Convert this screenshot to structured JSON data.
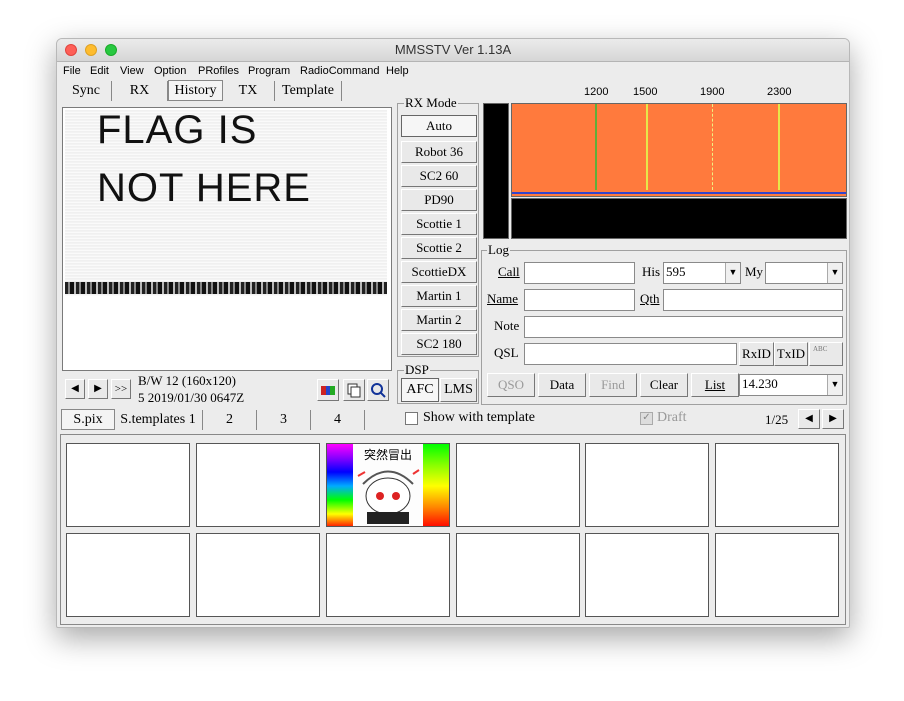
{
  "window": {
    "title": "MMSSTV Ver 1.13A"
  },
  "menu": [
    "File",
    "Edit",
    "View",
    "Option",
    "PRofiles",
    "Program",
    "RadioCommand",
    "Help"
  ],
  "tabs": [
    "Sync",
    "RX",
    "History",
    "TX",
    "Template"
  ],
  "image": {
    "line1": "FLAG IS",
    "line2": "NOT HERE"
  },
  "history_info": {
    "mode": "B/W 12 (160x120)",
    "entry": "5 2019/01/30 0647Z"
  },
  "nav": {
    "prev": "◀",
    "next": "▶",
    "skip": ">>"
  },
  "rx_mode": {
    "title": "RX Mode",
    "modes": [
      "Auto",
      "Robot 36",
      "SC2 60",
      "PD90",
      "Scottie 1",
      "Scottie 2",
      "ScottieDX",
      "Martin 1",
      "Martin 2",
      "SC2 180"
    ]
  },
  "dsp": {
    "title": "DSP",
    "afc": "AFC",
    "lms": "LMS"
  },
  "spectrum": {
    "labels": [
      "1200",
      "1500",
      "1900",
      "2300"
    ],
    "bg_color": "#ff7a3d"
  },
  "log": {
    "title": "Log",
    "call_label": "Call",
    "his_label": "His",
    "his_value": "595",
    "my_label": "My",
    "my_value": "",
    "name_label": "Name",
    "qth_label": "Qth",
    "note_label": "Note",
    "qsl_label": "QSL",
    "rxid": "RxID",
    "txid": "TxID",
    "abc": "ABC"
  },
  "log_buttons": {
    "qso": "QSO",
    "data": "Data",
    "find": "Find",
    "clear": "Clear",
    "list": "List",
    "freq": "14.230"
  },
  "bottom_tabs": [
    "S.pix",
    "S.templates 1",
    "2",
    "3",
    "4"
  ],
  "template": {
    "show_label": "Show with template",
    "draft_label": "Draft",
    "page": "1/25"
  },
  "thumbnail_text": "突然冒出"
}
